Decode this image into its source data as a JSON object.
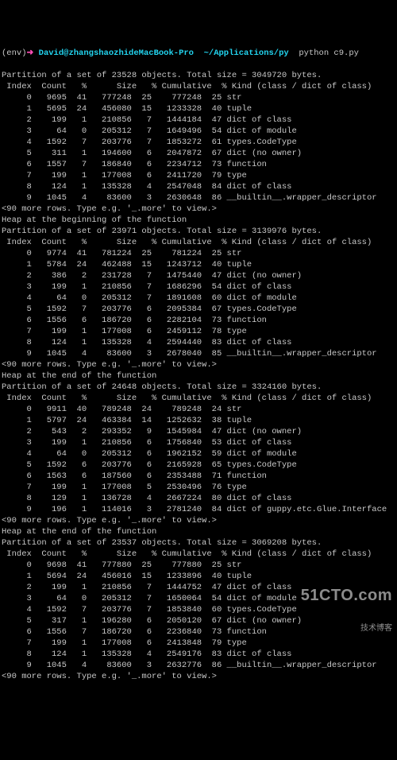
{
  "prompt": {
    "env": "(env)",
    "arrow": "➜",
    "user_host": "David@zhangshaozhideMacBook-Pro",
    "path": "~/Applications/py",
    "command": "python c9.py"
  },
  "more_line": "<90 more rows. Type e.g. '_.more' to view.>",
  "sections": [
    {
      "heap_line": null,
      "partition": "Partition of a set of 23528 objects. Total size = 3049720 bytes.",
      "header": {
        "c0": "Index",
        "c1": "Count",
        "c2": "%",
        "c3": "Size",
        "c4": "% Cumulative",
        "c5": "% Kind (class / dict of class)"
      },
      "rows": [
        {
          "idx": "0",
          "count": "9695",
          "pct": "41",
          "size": "777248",
          "pct2": "25",
          "cum": "777248",
          "kpct": "25",
          "kind": "str"
        },
        {
          "idx": "1",
          "count": "5695",
          "pct": "24",
          "size": "456080",
          "pct2": "15",
          "cum": "1233328",
          "kpct": "40",
          "kind": "tuple"
        },
        {
          "idx": "2",
          "count": "199",
          "pct": "1",
          "size": "210856",
          "pct2": "7",
          "cum": "1444184",
          "kpct": "47",
          "kind": "dict of class"
        },
        {
          "idx": "3",
          "count": "64",
          "pct": "0",
          "size": "205312",
          "pct2": "7",
          "cum": "1649496",
          "kpct": "54",
          "kind": "dict of module"
        },
        {
          "idx": "4",
          "count": "1592",
          "pct": "7",
          "size": "203776",
          "pct2": "7",
          "cum": "1853272",
          "kpct": "61",
          "kind": "types.CodeType"
        },
        {
          "idx": "5",
          "count": "311",
          "pct": "1",
          "size": "194600",
          "pct2": "6",
          "cum": "2047872",
          "kpct": "67",
          "kind": "dict (no owner)"
        },
        {
          "idx": "6",
          "count": "1557",
          "pct": "7",
          "size": "186840",
          "pct2": "6",
          "cum": "2234712",
          "kpct": "73",
          "kind": "function"
        },
        {
          "idx": "7",
          "count": "199",
          "pct": "1",
          "size": "177008",
          "pct2": "6",
          "cum": "2411720",
          "kpct": "79",
          "kind": "type"
        },
        {
          "idx": "8",
          "count": "124",
          "pct": "1",
          "size": "135328",
          "pct2": "4",
          "cum": "2547048",
          "kpct": "84",
          "kind": "dict of class"
        },
        {
          "idx": "9",
          "count": "1045",
          "pct": "4",
          "size": "83600",
          "pct2": "3",
          "cum": "2630648",
          "kpct": "86",
          "kind": "__builtin__.wrapper_descriptor"
        }
      ]
    },
    {
      "heap_line": "Heap at the beginning of the function",
      "partition": "Partition of a set of 23971 objects. Total size = 3139976 bytes.",
      "header": {
        "c0": "Index",
        "c1": "Count",
        "c2": "%",
        "c3": "Size",
        "c4": "% Cumulative",
        "c5": "% Kind (class / dict of class)"
      },
      "rows": [
        {
          "idx": "0",
          "count": "9774",
          "pct": "41",
          "size": "781224",
          "pct2": "25",
          "cum": "781224",
          "kpct": "25",
          "kind": "str"
        },
        {
          "idx": "1",
          "count": "5784",
          "pct": "24",
          "size": "462488",
          "pct2": "15",
          "cum": "1243712",
          "kpct": "40",
          "kind": "tuple"
        },
        {
          "idx": "2",
          "count": "386",
          "pct": "2",
          "size": "231728",
          "pct2": "7",
          "cum": "1475440",
          "kpct": "47",
          "kind": "dict (no owner)"
        },
        {
          "idx": "3",
          "count": "199",
          "pct": "1",
          "size": "210856",
          "pct2": "7",
          "cum": "1686296",
          "kpct": "54",
          "kind": "dict of class"
        },
        {
          "idx": "4",
          "count": "64",
          "pct": "0",
          "size": "205312",
          "pct2": "7",
          "cum": "1891608",
          "kpct": "60",
          "kind": "dict of module"
        },
        {
          "idx": "5",
          "count": "1592",
          "pct": "7",
          "size": "203776",
          "pct2": "6",
          "cum": "2095384",
          "kpct": "67",
          "kind": "types.CodeType"
        },
        {
          "idx": "6",
          "count": "1556",
          "pct": "6",
          "size": "186720",
          "pct2": "6",
          "cum": "2282104",
          "kpct": "73",
          "kind": "function"
        },
        {
          "idx": "7",
          "count": "199",
          "pct": "1",
          "size": "177008",
          "pct2": "6",
          "cum": "2459112",
          "kpct": "78",
          "kind": "type"
        },
        {
          "idx": "8",
          "count": "124",
          "pct": "1",
          "size": "135328",
          "pct2": "4",
          "cum": "2594440",
          "kpct": "83",
          "kind": "dict of class"
        },
        {
          "idx": "9",
          "count": "1045",
          "pct": "4",
          "size": "83600",
          "pct2": "3",
          "cum": "2678040",
          "kpct": "85",
          "kind": "__builtin__.wrapper_descriptor"
        }
      ]
    },
    {
      "heap_line": "Heap at the end of the function",
      "partition": "Partition of a set of 24648 objects. Total size = 3324160 bytes.",
      "header": {
        "c0": "Index",
        "c1": "Count",
        "c2": "%",
        "c3": "Size",
        "c4": "% Cumulative",
        "c5": "% Kind (class / dict of class)"
      },
      "rows": [
        {
          "idx": "0",
          "count": "9911",
          "pct": "40",
          "size": "789248",
          "pct2": "24",
          "cum": "789248",
          "kpct": "24",
          "kind": "str"
        },
        {
          "idx": "1",
          "count": "5797",
          "pct": "24",
          "size": "463384",
          "pct2": "14",
          "cum": "1252632",
          "kpct": "38",
          "kind": "tuple"
        },
        {
          "idx": "2",
          "count": "543",
          "pct": "2",
          "size": "293352",
          "pct2": "9",
          "cum": "1545984",
          "kpct": "47",
          "kind": "dict (no owner)"
        },
        {
          "idx": "3",
          "count": "199",
          "pct": "1",
          "size": "210856",
          "pct2": "6",
          "cum": "1756840",
          "kpct": "53",
          "kind": "dict of class"
        },
        {
          "idx": "4",
          "count": "64",
          "pct": "0",
          "size": "205312",
          "pct2": "6",
          "cum": "1962152",
          "kpct": "59",
          "kind": "dict of module"
        },
        {
          "idx": "5",
          "count": "1592",
          "pct": "6",
          "size": "203776",
          "pct2": "6",
          "cum": "2165928",
          "kpct": "65",
          "kind": "types.CodeType"
        },
        {
          "idx": "6",
          "count": "1563",
          "pct": "6",
          "size": "187560",
          "pct2": "6",
          "cum": "2353488",
          "kpct": "71",
          "kind": "function"
        },
        {
          "idx": "7",
          "count": "199",
          "pct": "1",
          "size": "177008",
          "pct2": "5",
          "cum": "2530496",
          "kpct": "76",
          "kind": "type"
        },
        {
          "idx": "8",
          "count": "129",
          "pct": "1",
          "size": "136728",
          "pct2": "4",
          "cum": "2667224",
          "kpct": "80",
          "kind": "dict of class"
        },
        {
          "idx": "9",
          "count": "196",
          "pct": "1",
          "size": "114016",
          "pct2": "3",
          "cum": "2781240",
          "kpct": "84",
          "kind": "dict of guppy.etc.Glue.Interface"
        }
      ]
    },
    {
      "heap_line": "Heap at the end of the function",
      "partition": "Partition of a set of 23537 objects. Total size = 3069208 bytes.",
      "header": {
        "c0": "Index",
        "c1": "Count",
        "c2": "%",
        "c3": "Size",
        "c4": "% Cumulative",
        "c5": "% Kind (class / dict of class)"
      },
      "rows": [
        {
          "idx": "0",
          "count": "9698",
          "pct": "41",
          "size": "777880",
          "pct2": "25",
          "cum": "777880",
          "kpct": "25",
          "kind": "str"
        },
        {
          "idx": "1",
          "count": "5694",
          "pct": "24",
          "size": "456016",
          "pct2": "15",
          "cum": "1233896",
          "kpct": "40",
          "kind": "tuple"
        },
        {
          "idx": "2",
          "count": "199",
          "pct": "1",
          "size": "210856",
          "pct2": "7",
          "cum": "1444752",
          "kpct": "47",
          "kind": "dict of class"
        },
        {
          "idx": "3",
          "count": "64",
          "pct": "0",
          "size": "205312",
          "pct2": "7",
          "cum": "1650064",
          "kpct": "54",
          "kind": "dict of module"
        },
        {
          "idx": "4",
          "count": "1592",
          "pct": "7",
          "size": "203776",
          "pct2": "7",
          "cum": "1853840",
          "kpct": "60",
          "kind": "types.CodeType"
        },
        {
          "idx": "5",
          "count": "317",
          "pct": "1",
          "size": "196280",
          "pct2": "6",
          "cum": "2050120",
          "kpct": "67",
          "kind": "dict (no owner)"
        },
        {
          "idx": "6",
          "count": "1556",
          "pct": "7",
          "size": "186720",
          "pct2": "6",
          "cum": "2236840",
          "kpct": "73",
          "kind": "function"
        },
        {
          "idx": "7",
          "count": "199",
          "pct": "1",
          "size": "177008",
          "pct2": "6",
          "cum": "2413848",
          "kpct": "79",
          "kind": "type"
        },
        {
          "idx": "8",
          "count": "124",
          "pct": "1",
          "size": "135328",
          "pct2": "4",
          "cum": "2549176",
          "kpct": "83",
          "kind": "dict of class"
        },
        {
          "idx": "9",
          "count": "1045",
          "pct": "4",
          "size": "83600",
          "pct2": "3",
          "cum": "2632776",
          "kpct": "86",
          "kind": "__builtin__.wrapper_descriptor"
        }
      ]
    }
  ],
  "watermark": {
    "big": "51CTO.com",
    "small": "技术博客"
  }
}
